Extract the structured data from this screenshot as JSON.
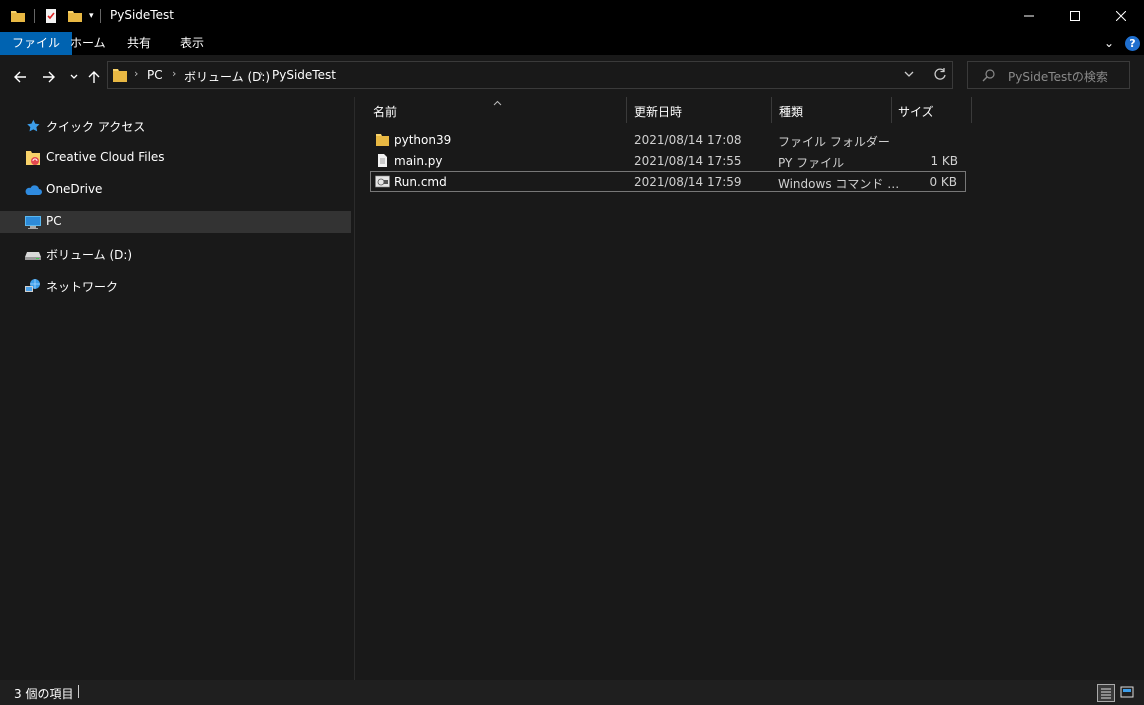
{
  "window": {
    "title": "PySideTest",
    "minimize_icon": "minimize-icon",
    "maximize_icon": "maximize-icon",
    "close_icon": "close-icon"
  },
  "ribbon": {
    "tabs": [
      {
        "label": "ファイル",
        "active": true
      },
      {
        "label": "ホーム",
        "active": false
      },
      {
        "label": "共有",
        "active": false
      },
      {
        "label": "表示",
        "active": false
      }
    ]
  },
  "address": {
    "crumbs": [
      "PC",
      "ボリューム (D:)",
      "PySideTest"
    ]
  },
  "search": {
    "placeholder": "PySideTestの検索"
  },
  "navpane": {
    "items": [
      {
        "label": "クイック アクセス",
        "icon": "star-icon"
      },
      {
        "label": "Creative Cloud Files",
        "icon": "creative-cloud-folder-icon"
      },
      {
        "label": "OneDrive",
        "icon": "cloud-icon"
      },
      {
        "label": "PC",
        "icon": "computer-icon",
        "selected": true
      },
      {
        "label": "ボリューム (D:)",
        "icon": "drive-icon"
      },
      {
        "label": "ネットワーク",
        "icon": "network-icon"
      }
    ]
  },
  "columns": {
    "name": "名前",
    "date": "更新日時",
    "type": "種類",
    "size": "サイズ"
  },
  "files": [
    {
      "name": "python39",
      "date": "2021/08/14 17:08",
      "type": "ファイル フォルダー",
      "size": "",
      "icon": "folder-icon"
    },
    {
      "name": "main.py",
      "date": "2021/08/14 17:55",
      "type": "PY ファイル",
      "size": "1 KB",
      "icon": "file-icon"
    },
    {
      "name": "Run.cmd",
      "date": "2021/08/14 17:59",
      "type": "Windows コマンド …",
      "size": "0 KB",
      "icon": "cmd-icon"
    }
  ],
  "status": {
    "count_text": "3 個の項目"
  },
  "colors": {
    "accent": "#0063b1",
    "folder": "#f8d26a",
    "background": "#191919"
  }
}
